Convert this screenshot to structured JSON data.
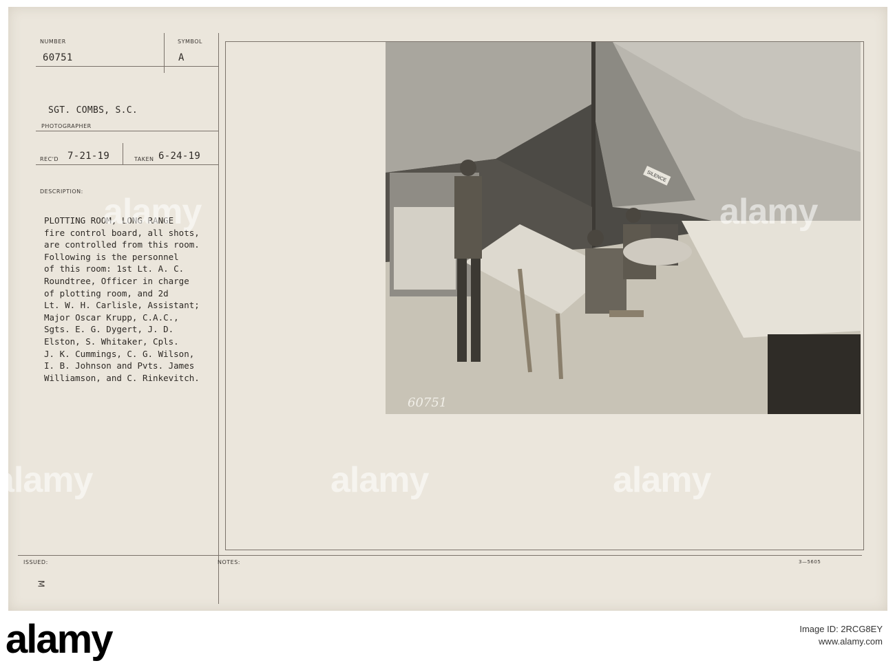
{
  "card": {
    "number_label": "NUMBER",
    "number_value": "60751",
    "symbol_label": "SYMBOL",
    "symbol_value": "A",
    "photographer_name": "SGT. COMBS, S.C.",
    "photographer_label": "PHOTOGRAPHER",
    "recd_label": "REC'D",
    "recd_value": "7-21-19",
    "taken_label": "TAKEN",
    "taken_value": "6-24-19",
    "description_label": "DESCRIPTION:",
    "description_lines": [
      "PLOTTING ROOM, LONG RANGE",
      "fire control board, all shots,",
      "are controlled from this room.",
      "Following is the personnel",
      "of this room: 1st Lt. A. C.",
      "Roundtree, Officer in charge",
      "of plotting room, and 2d",
      "Lt. W. H. Carlisle, Assistant;",
      "Major Oscar Krupp, C.A.C.,",
      "Sgts. E. G. Dygert, J. D.",
      "Elston, S. Whitaker, Cpls.",
      "J. K. Cummings, C. G. Wilson,",
      "I. B. Johnson and Pvts. James",
      "Williamson, and C. Rinkevitch."
    ],
    "issued_label": "ISSUED:",
    "notes_label": "NOTES:",
    "form_number": "3—5605",
    "corner_mark": "M",
    "photo_number": "60751",
    "tent_sign": "SILENCE"
  },
  "watermarks": [
    "alamy",
    "alamy",
    "alamy",
    "alamy",
    "alamy"
  ],
  "footer": {
    "logo": "alamy",
    "image_id_label": "Image ID: 2RCG8EY",
    "site": "www.alamy.com"
  }
}
